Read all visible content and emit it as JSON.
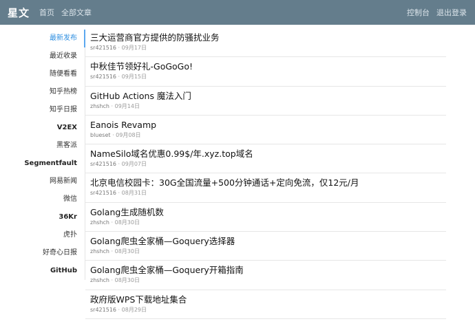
{
  "header": {
    "brand": "星文",
    "nav": [
      "首页",
      "全部文章"
    ],
    "right": [
      "控制台",
      "退出登录"
    ]
  },
  "sidebar": {
    "items": [
      {
        "label": "最新发布",
        "active": true
      },
      {
        "label": "最近收录"
      },
      {
        "label": "随便看看"
      },
      {
        "label": "知乎热榜"
      },
      {
        "label": "知乎日报"
      },
      {
        "label": "V2EX"
      },
      {
        "label": "黑客派"
      },
      {
        "label": "Segmentfault"
      },
      {
        "label": "网易新闻"
      },
      {
        "label": "微信"
      },
      {
        "label": "36Kr"
      },
      {
        "label": "虎扑"
      },
      {
        "label": "好奇心日报"
      },
      {
        "label": "GitHub"
      }
    ]
  },
  "articles": [
    {
      "title": "三大运营商官方提供的防骚扰业务",
      "author": "sr421516",
      "date": "09月17日"
    },
    {
      "title": "中秋佳节领好礼-GoGoGo!",
      "author": "sr421516",
      "date": "09月15日"
    },
    {
      "title": "GitHub Actions 魔法入门",
      "author": "zhshch",
      "date": "09月14日"
    },
    {
      "title": "Eanois Revamp",
      "author": "blueset",
      "date": "09月08日"
    },
    {
      "title": "NameSilo域名优惠0.99$/年.xyz.top域名",
      "author": "sr421516",
      "date": "09月07日"
    },
    {
      "title": "北京电信校园卡：30G全国流量+500分钟通话+定向免流，仅12元/月",
      "author": "sr421516",
      "date": "08月31日"
    },
    {
      "title": "Golang生成随机数",
      "author": "zhshch",
      "date": "08月30日"
    },
    {
      "title": "Golang爬虫全家桶—Goquery选择器",
      "author": "zhshch",
      "date": "08月30日"
    },
    {
      "title": "Golang爬虫全家桶—Goquery开箱指南",
      "author": "zhshch",
      "date": "08月30日"
    },
    {
      "title": "政府版WPS下载地址集合",
      "author": "sr421516",
      "date": "08月29日"
    }
  ]
}
